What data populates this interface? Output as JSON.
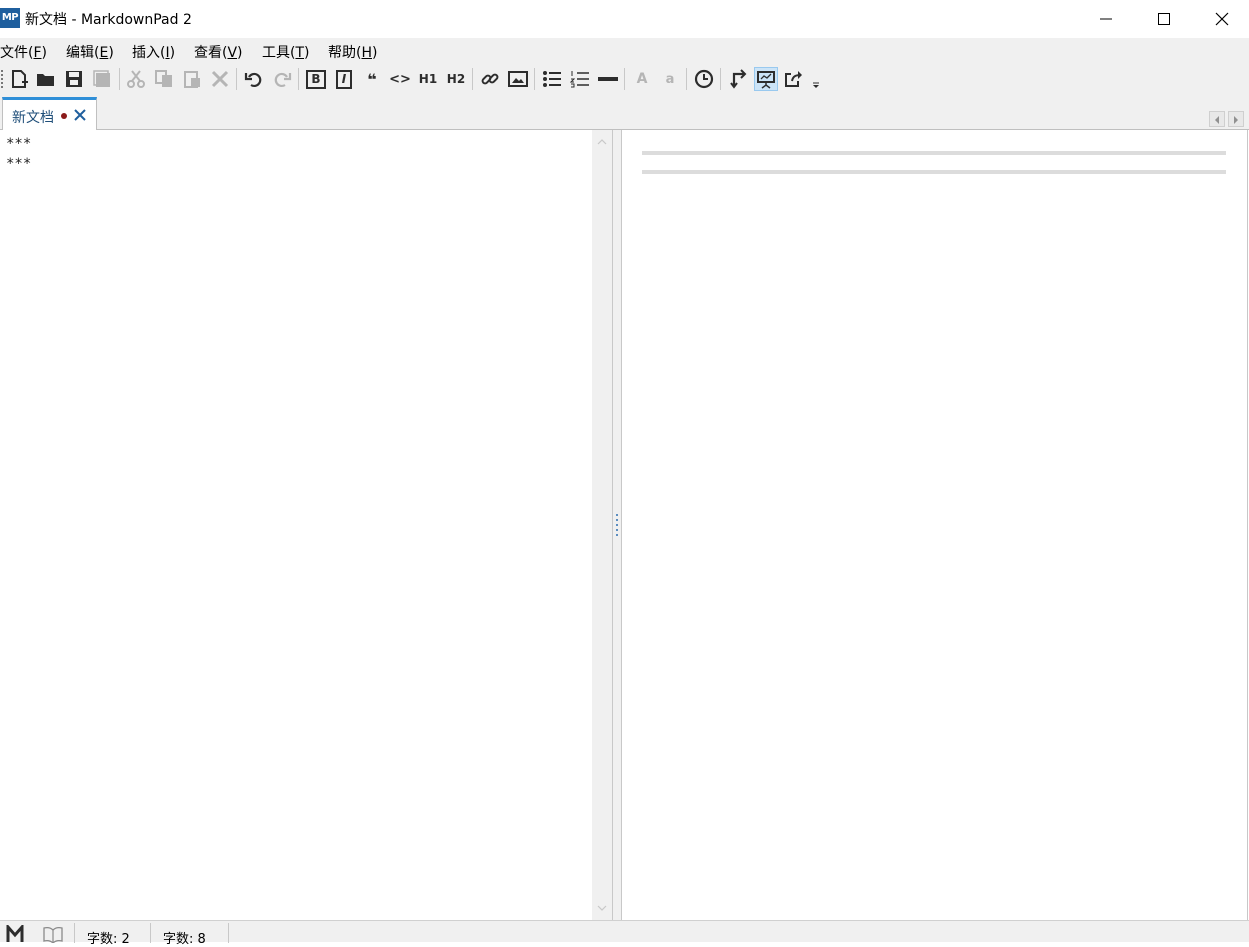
{
  "window": {
    "icon_text": "MP",
    "title": "新文档 - MarkdownPad 2"
  },
  "menu": [
    {
      "label": "文件(",
      "key": "F",
      "end": ")"
    },
    {
      "label": "编辑(",
      "key": "E",
      "end": ")"
    },
    {
      "label": "插入(",
      "key": "I",
      "end": ")"
    },
    {
      "label": "查看(",
      "key": "V",
      "end": ")"
    },
    {
      "label": "工具(",
      "key": "T",
      "end": ")"
    },
    {
      "label": "帮助(",
      "key": "H",
      "end": ")"
    }
  ],
  "toolbar": {
    "h1_label": "H1",
    "h2_label": "H2",
    "bold_label": "B",
    "italic_label": "I",
    "quote_label": "❝",
    "code_label": "<>",
    "upper_a_label": "A",
    "lower_a_label": "a",
    "icons": [
      "new-document-icon",
      "open-folder-icon",
      "save-icon",
      "save-all-icon",
      "cut-icon",
      "copy-icon",
      "paste-icon",
      "delete-icon",
      "undo-icon",
      "redo-icon",
      "bold-icon",
      "italic-icon",
      "quote-icon",
      "code-icon",
      "h1-icon",
      "h2-icon",
      "link-icon",
      "image-icon",
      "bullet-list-icon",
      "numbered-list-icon",
      "horizontal-rule-icon",
      "uppercase-icon",
      "lowercase-icon",
      "timestamp-icon",
      "live-preview-icon",
      "presentation-icon",
      "export-icon",
      "toolbar-overflow-icon"
    ]
  },
  "tab": {
    "label": "新文档"
  },
  "editor": {
    "lines": [
      "***",
      "***"
    ]
  },
  "status": {
    "words": "字数: 2",
    "chars": "字数: 8"
  }
}
